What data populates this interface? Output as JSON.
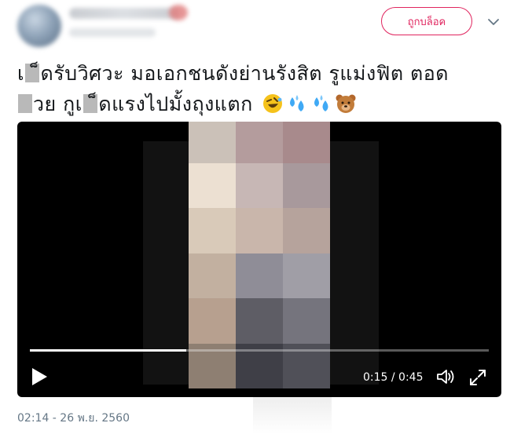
{
  "tweet": {
    "lines": [
      "เ▒็ดรับวิศวะ มอเอกชนดังย่านรังสิต รูแม่งฟิต ตอด",
      "▒วย กูเ▒็ดแรงไปมั้งถุงแตก"
    ],
    "line1": {
      "a": "เ",
      "b": "็ดรับวิศวะ  มอเอกชนดังย่านรังสิต  รูแม่งฟิต ตอด"
    },
    "line2": {
      "a": "วย  กูเ",
      "b": "็ดแรงไปมั้งถุงแตก"
    },
    "emojis": [
      "rolling-on-floor-laughing-icon",
      "sweat-droplets-icon",
      "sweat-droplets-icon",
      "bear-face-icon"
    ],
    "timestamp": "02:14 - 26 พ.ย. 2560"
  },
  "header": {
    "block_label": "ถูกบล็อค",
    "chevron_icon": "chevron-down-icon"
  },
  "video": {
    "time_text": "0:15 / 0:45",
    "progress": 0.34,
    "icons": [
      "play-icon",
      "volume-icon",
      "fullscreen-icon"
    ],
    "mosaic_colors": [
      "#cbc1b8",
      "#b49c9d",
      "#a88a8c",
      "#ece0d2",
      "#c7b7b5",
      "#a8999c",
      "#d9cab9",
      "#c9b6ab",
      "#b6a39c",
      "#c2b0a0",
      "#8f8d97",
      "#a09ea6",
      "#b7a08f",
      "#5e5d65",
      "#75747d",
      "#8e7f72",
      "#3f3f47",
      "#505058"
    ]
  },
  "colors": {
    "accent": "#e0245e",
    "text": "#14171a",
    "muted": "#657786"
  }
}
